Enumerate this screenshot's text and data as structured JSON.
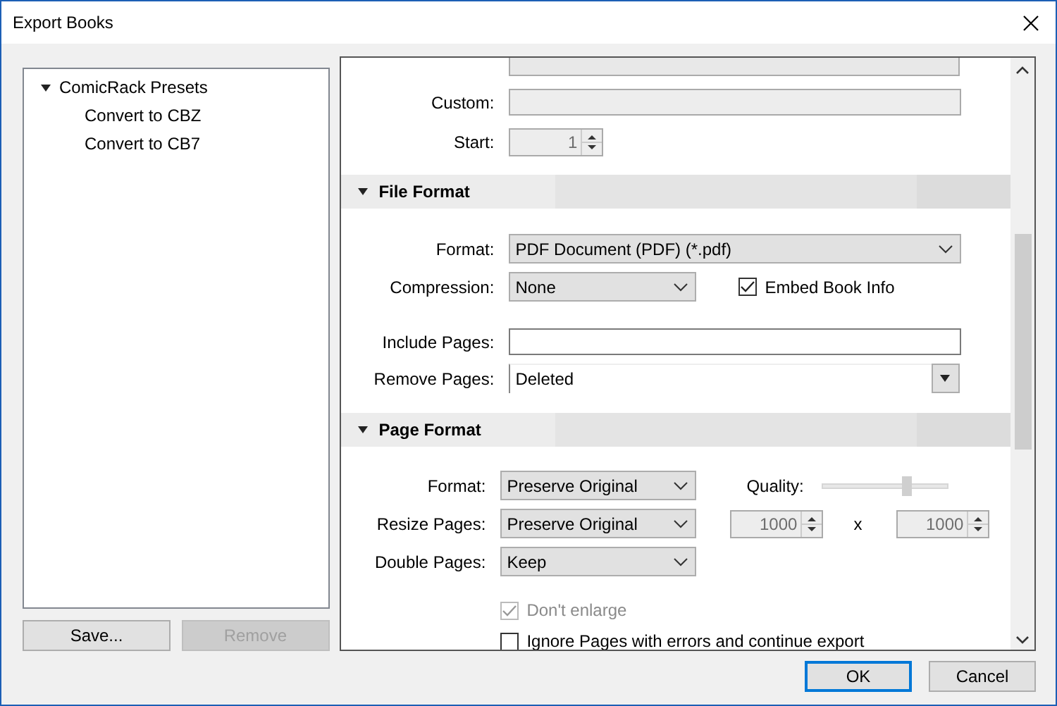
{
  "window": {
    "title": "Export Books"
  },
  "presets": {
    "label": "ComicRack Presets",
    "expanded": true,
    "children": [
      {
        "label": "Convert to CBZ"
      },
      {
        "label": "Convert to CB7"
      }
    ]
  },
  "preset_buttons": [
    {
      "label": "Save...",
      "disabled": false
    },
    {
      "label": "Remove",
      "disabled": true
    }
  ],
  "naming": {
    "custom": {
      "label": "Custom:",
      "disabled": true
    },
    "start": {
      "label": "Start:",
      "value": "1",
      "disabled": true
    }
  },
  "file_format": {
    "title": "File Format",
    "expanded": true,
    "format": {
      "label": "Format:",
      "value": "PDF Document (PDF) (*.pdf)"
    },
    "compression": {
      "label": "Compression:",
      "value": "None"
    },
    "embed": {
      "label": "Embed Book Info",
      "checked": true,
      "disabled": false
    },
    "include": {
      "label": "Include Pages:"
    },
    "remove": {
      "label": "Remove Pages:",
      "value": "Deleted"
    }
  },
  "page_format": {
    "title": "Page Format",
    "expanded": true,
    "format": {
      "label": "Format:",
      "value": "Preserve Original"
    },
    "resize": {
      "label": "Resize Pages:",
      "value": "Preserve Original"
    },
    "double": {
      "label": "Double Pages:",
      "value": "Keep"
    },
    "quality": {
      "label": "Quality:",
      "level": 0.72
    },
    "width": {
      "value": "1000",
      "disabled": true
    },
    "times": "x",
    "height": {
      "value": "1000",
      "disabled": true
    },
    "dont_enlarge": {
      "label": "Don't enlarge",
      "checked": true,
      "disabled": true
    },
    "ignore_errors": {
      "label": "Ignore Pages with errors and continue export",
      "checked": false,
      "disabled": false
    }
  },
  "buttons": [
    {
      "label": "OK",
      "default": true
    },
    {
      "label": "Cancel",
      "default": false
    }
  ]
}
